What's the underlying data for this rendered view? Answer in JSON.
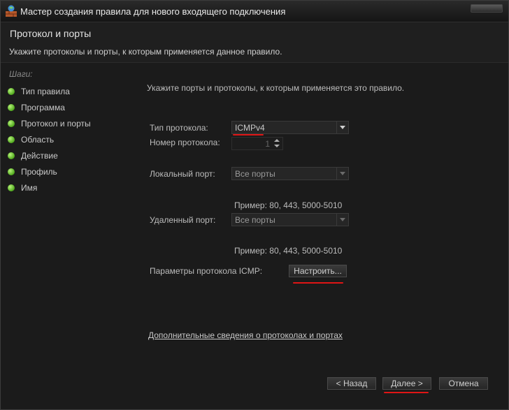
{
  "window": {
    "title": "Мастер создания правила для нового входящего подключения"
  },
  "header": {
    "title": "Протокол и порты",
    "subtitle": "Укажите протоколы и порты, к которым применяется данное правило."
  },
  "steps": {
    "heading": "Шаги:",
    "items": [
      {
        "label": "Тип правила"
      },
      {
        "label": "Программа"
      },
      {
        "label": "Протокол и порты"
      },
      {
        "label": "Область"
      },
      {
        "label": "Действие"
      },
      {
        "label": "Профиль"
      },
      {
        "label": "Имя"
      }
    ]
  },
  "form": {
    "intro": "Укажите порты и протоколы, к которым применяется это правило.",
    "protocol_type_label": "Тип протокола:",
    "protocol_type_value": "ICMPv4",
    "protocol_number_label": "Номер протокола:",
    "protocol_number_value": "1",
    "local_port_label": "Локальный порт:",
    "local_port_value": "Все порты",
    "local_port_example": "Пример: 80, 443, 5000-5010",
    "remote_port_label": "Удаленный порт:",
    "remote_port_value": "Все порты",
    "remote_port_example": "Пример: 80, 443, 5000-5010",
    "icmp_label": "Параметры протокола ICMP:",
    "icmp_button": "Настроить..."
  },
  "link": "Дополнительные сведения о протоколах и портах",
  "buttons": {
    "back": "< Назад",
    "next": "Далее >",
    "cancel": "Отмена"
  },
  "colors": {
    "highlight": "#e01515",
    "step_dot": "#4fa81c"
  }
}
